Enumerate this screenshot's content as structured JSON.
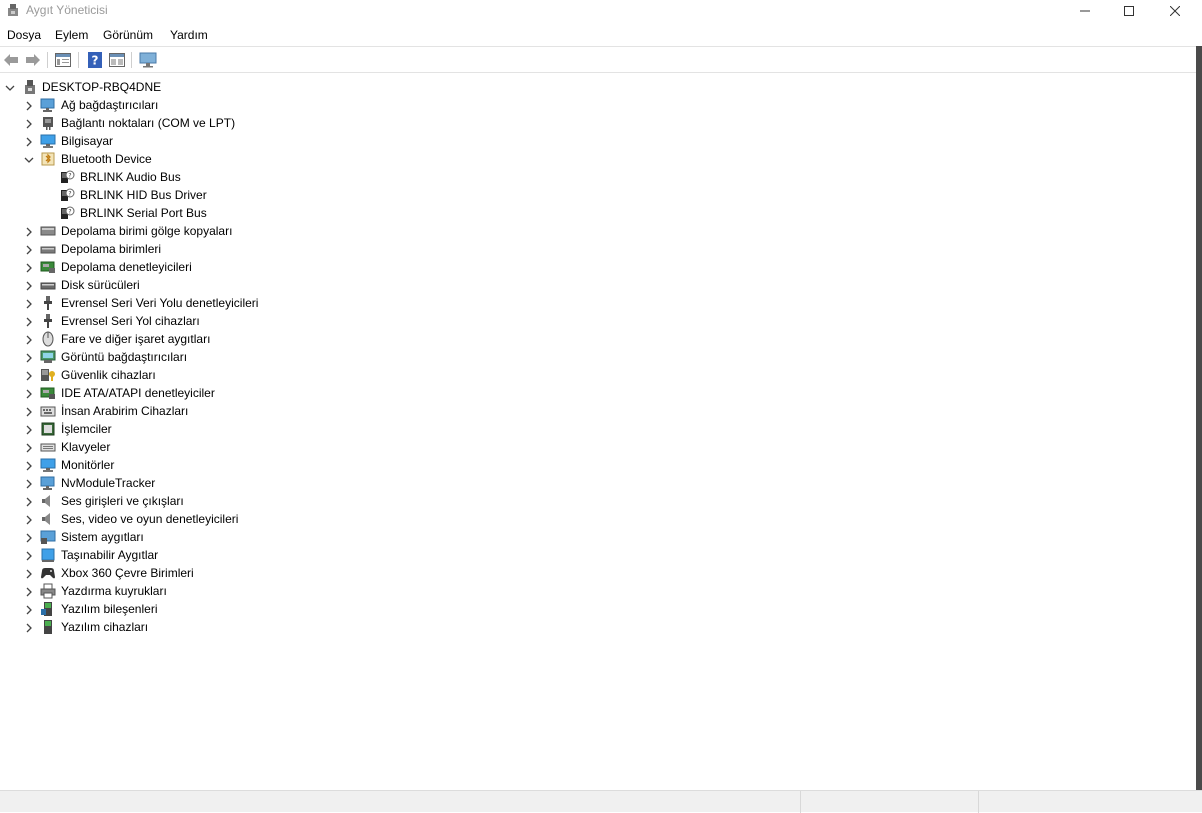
{
  "window": {
    "title": "Aygıt Yöneticisi"
  },
  "menu": {
    "items": [
      "Dosya",
      "Eylem",
      "Görünüm",
      "Yardım"
    ]
  },
  "toolbar": {
    "buttons": [
      "back-arrow-icon",
      "forward-arrow-icon",
      "properties-icon",
      "help-icon",
      "view-icon",
      "monitor-scan-icon"
    ]
  },
  "tree": {
    "root": "DESKTOP-RBQ4DNE",
    "categories": [
      {
        "label": "Ağ bağdaştırıcıları",
        "icon": "network-adapter-icon",
        "expanded": false
      },
      {
        "label": "Bağlantı noktaları (COM ve LPT)",
        "icon": "port-icon",
        "expanded": false
      },
      {
        "label": "Bilgisayar",
        "icon": "computer-icon",
        "expanded": false
      },
      {
        "label": "Bluetooth Device",
        "icon": "bluetooth-device-icon",
        "expanded": true,
        "children": [
          "BRLINK Audio Bus",
          "BRLINK HID Bus Driver",
          "BRLINK Serial Port Bus"
        ]
      },
      {
        "label": "Depolama birimi gölge kopyaları",
        "icon": "storage-shadow-icon",
        "expanded": false
      },
      {
        "label": "Depolama birimleri",
        "icon": "storage-volume-icon",
        "expanded": false
      },
      {
        "label": "Depolama denetleyicileri",
        "icon": "storage-controller-icon",
        "expanded": false
      },
      {
        "label": "Disk sürücüleri",
        "icon": "disk-drive-icon",
        "expanded": false
      },
      {
        "label": "Evrensel Seri Veri Yolu denetleyicileri",
        "icon": "usb-icon",
        "expanded": false
      },
      {
        "label": "Evrensel Seri Yol cihazları",
        "icon": "usb-device-icon",
        "expanded": false
      },
      {
        "label": "Fare ve diğer işaret aygıtları",
        "icon": "mouse-icon",
        "expanded": false
      },
      {
        "label": "Görüntü bağdaştırıcıları",
        "icon": "display-adapter-icon",
        "expanded": false
      },
      {
        "label": "Güvenlik cihazları",
        "icon": "security-device-icon",
        "expanded": false
      },
      {
        "label": "IDE ATA/ATAPI denetleyiciler",
        "icon": "ide-controller-icon",
        "expanded": false
      },
      {
        "label": "İnsan Arabirim Cihazları",
        "icon": "hid-icon",
        "expanded": false
      },
      {
        "label": "İşlemciler",
        "icon": "processor-icon",
        "expanded": false
      },
      {
        "label": "Klavyeler",
        "icon": "keyboard-icon",
        "expanded": false
      },
      {
        "label": "Monitörler",
        "icon": "monitor-icon",
        "expanded": false
      },
      {
        "label": "NvModuleTracker",
        "icon": "nvmodule-icon",
        "expanded": false
      },
      {
        "label": "Ses girişleri ve çıkışları",
        "icon": "audio-io-icon",
        "expanded": false
      },
      {
        "label": "Ses, video ve oyun denetleyicileri",
        "icon": "sound-controller-icon",
        "expanded": false
      },
      {
        "label": "Sistem aygıtları",
        "icon": "system-device-icon",
        "expanded": false
      },
      {
        "label": "Taşınabilir Aygıtlar",
        "icon": "portable-device-icon",
        "expanded": false
      },
      {
        "label": "Xbox 360 Çevre Birimleri",
        "icon": "gamepad-icon",
        "expanded": false
      },
      {
        "label": "Yazdırma kuyrukları",
        "icon": "printer-icon",
        "expanded": false
      },
      {
        "label": "Yazılım bileşenleri",
        "icon": "software-component-icon",
        "expanded": false
      },
      {
        "label": "Yazılım cihazları",
        "icon": "software-device-icon",
        "expanded": false
      }
    ]
  }
}
